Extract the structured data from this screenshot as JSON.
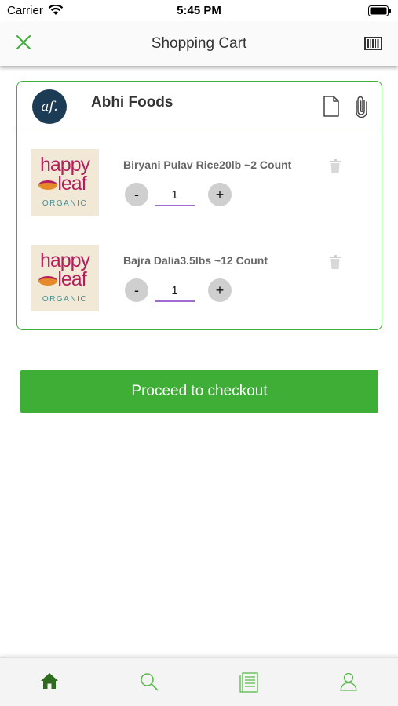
{
  "status_bar": {
    "carrier": "Carrier",
    "time": "5:45 PM"
  },
  "nav": {
    "title": "Shopping Cart"
  },
  "store": {
    "name": "Abhi Foods",
    "logo_text": "af."
  },
  "items": [
    {
      "name": "Biryani Pulav Rice20lb ~2 Count",
      "quantity": "1",
      "minus": "-",
      "plus": "+",
      "brand_logo": {
        "line1": "happy",
        "line2": "leaf",
        "line3": "ORGANIC"
      }
    },
    {
      "name": "Bajra Dalia3.5lbs ~12 Count",
      "quantity": "1",
      "minus": "-",
      "plus": "+",
      "brand_logo": {
        "line1": "happy",
        "line2": "leaf",
        "line3": "ORGANIC"
      }
    }
  ],
  "checkout": {
    "label": "Proceed to checkout"
  },
  "tabs": [
    {
      "icon": "home-icon",
      "active": true
    },
    {
      "icon": "search-icon",
      "active": false
    },
    {
      "icon": "orders-icon",
      "active": false
    },
    {
      "icon": "profile-icon",
      "active": false
    }
  ],
  "colors": {
    "accent": "#3fae3a",
    "active_tab": "#2f6b1e",
    "qty_underline": "#a06ad1",
    "logo_bg": "#1c3b55"
  }
}
